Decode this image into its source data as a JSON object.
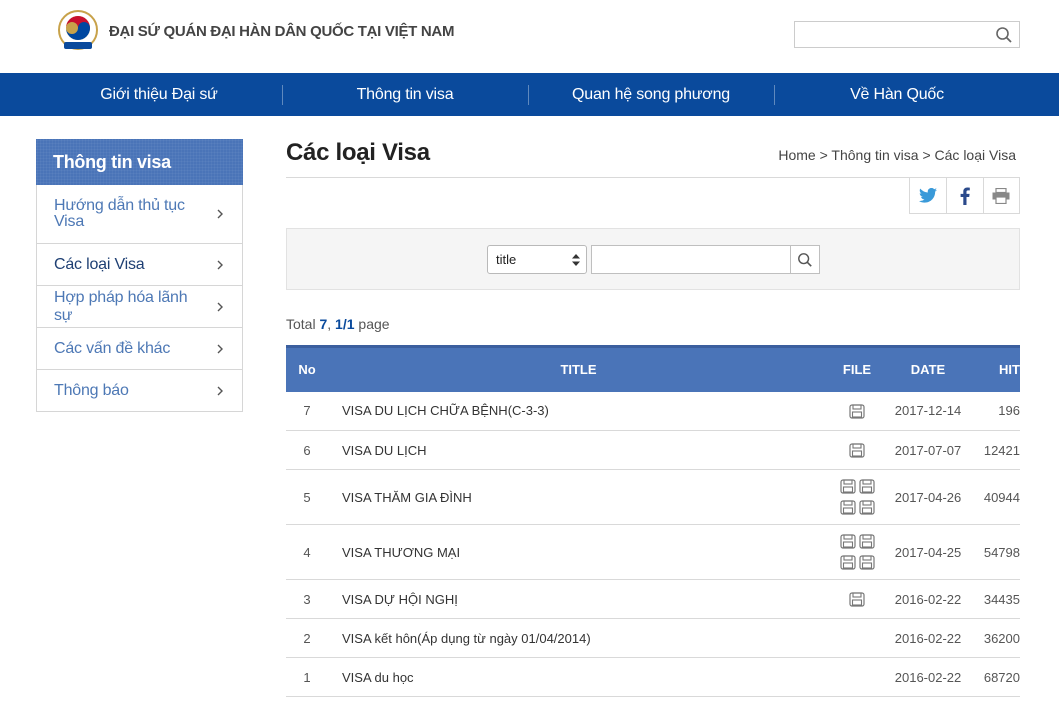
{
  "header": {
    "site_title": "ĐẠI SỨ QUÁN ĐẠI HÀN DÂN QUỐC TẠI VIỆT NAM",
    "search_placeholder": ""
  },
  "nav": [
    "Giới thiệu Đại sứ",
    "Thông tin visa",
    "Quan hệ song phương",
    "Về Hàn Quốc"
  ],
  "sidebar": {
    "heading": "Thông tin visa",
    "items": [
      {
        "label": "Hướng dẫn thủ tục Visa",
        "active": false
      },
      {
        "label": "Các loại Visa",
        "active": true
      },
      {
        "label": "Hợp pháp hóa lãnh sự",
        "active": false
      },
      {
        "label": "Các vấn đề khác",
        "active": false
      },
      {
        "label": "Thông báo",
        "active": false
      }
    ]
  },
  "main": {
    "page_title": "Các loại Visa",
    "breadcrumb": "Home > Thông tin visa > Các loại Visa",
    "search": {
      "select_value": "title",
      "input_value": ""
    },
    "total": {
      "prefix": "Total ",
      "count": "7",
      "sep": ", ",
      "pages": "1/1",
      "suffix": " page"
    }
  },
  "table": {
    "headers": [
      "No",
      "TITLE",
      "FILE",
      "DATE",
      "HIT"
    ],
    "rows": [
      {
        "no": "7",
        "title": "VISA DU LỊCH CHỮA BỆNH(C-3-3)",
        "files": 1,
        "date": "2017-12-14",
        "hit": "196"
      },
      {
        "no": "6",
        "title": "VISA DU LỊCH",
        "files": 1,
        "date": "2017-07-07",
        "hit": "12421"
      },
      {
        "no": "5",
        "title": "VISA THĂM GIA ĐÌNH",
        "files": 4,
        "date": "2017-04-26",
        "hit": "40944"
      },
      {
        "no": "4",
        "title": "VISA THƯƠNG MẠI",
        "files": 4,
        "date": "2017-04-25",
        "hit": "54798"
      },
      {
        "no": "3",
        "title": "VISA DỰ HỘI NGHỊ",
        "files": 1,
        "date": "2016-02-22",
        "hit": "34435"
      },
      {
        "no": "2",
        "title": "VISA kết hôn(Áp dụng từ ngày 01/04/2014)",
        "files": 0,
        "date": "2016-02-22",
        "hit": "36200"
      },
      {
        "no": "1",
        "title": "VISA du học",
        "files": 0,
        "date": "2016-02-22",
        "hit": "68720"
      }
    ]
  },
  "colors": {
    "nav_blue": "#0a4a9c",
    "header_blue": "#4a74b8",
    "link_blue": "#4d78b5"
  },
  "icons": {
    "logo": "embassy-emblem-icon",
    "search": "search-icon",
    "twitter": "twitter-icon",
    "facebook": "facebook-icon",
    "print": "print-icon",
    "file": "floppy-disk-icon"
  }
}
